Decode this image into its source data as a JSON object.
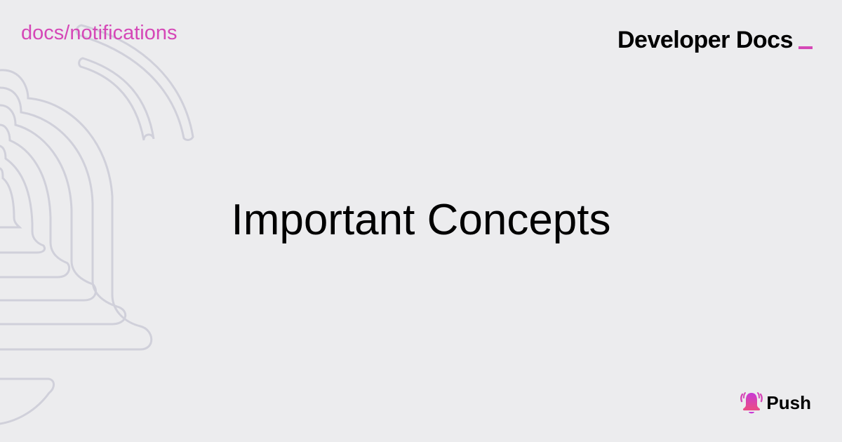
{
  "header": {
    "breadcrumb": "docs/notifications",
    "brand_title": "Developer Docs"
  },
  "main": {
    "title": "Important Concepts"
  },
  "logo": {
    "text": "Push",
    "icon": "bell-icon"
  },
  "decoration": {
    "icon": "bell-outline-icon"
  },
  "colors": {
    "accent": "#d548b7",
    "background": "#ececee",
    "decoration_stroke": "#d0d0da",
    "text": "#000000"
  }
}
